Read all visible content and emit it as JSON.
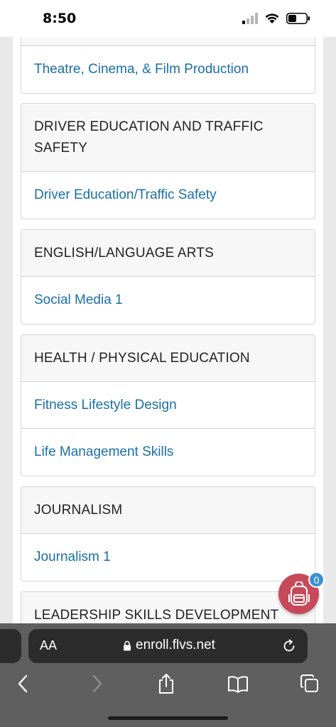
{
  "status_bar": {
    "time": "8:50"
  },
  "sections": [
    {
      "heading": "",
      "courses": [
        "Theatre, Cinema, & Film Production"
      ]
    },
    {
      "heading": "DRIVER EDUCATION AND TRAFFIC SAFETY",
      "courses": [
        "Driver Education/Traffic Safety"
      ]
    },
    {
      "heading": "ENGLISH/LANGUAGE ARTS",
      "courses": [
        "Social Media 1"
      ]
    },
    {
      "heading": "HEALTH / PHYSICAL EDUCATION",
      "courses": [
        "Fitness Lifestyle Design",
        "Life Management Skills"
      ]
    },
    {
      "heading": "JOURNALISM",
      "courses": [
        "Journalism 1"
      ]
    },
    {
      "heading": "LEADERSHIP SKILLS DEVELOPMENT",
      "courses": []
    }
  ],
  "cart": {
    "count": "0",
    "icon": "backpack-icon",
    "color": "#c64a5a"
  },
  "browser": {
    "aa_label": "AA",
    "url": "enroll.flvs.net"
  },
  "colors": {
    "link": "#1a6fa6",
    "heading_bg": "#f7f7f7",
    "toolbar_bg": "#5f5f5f"
  }
}
